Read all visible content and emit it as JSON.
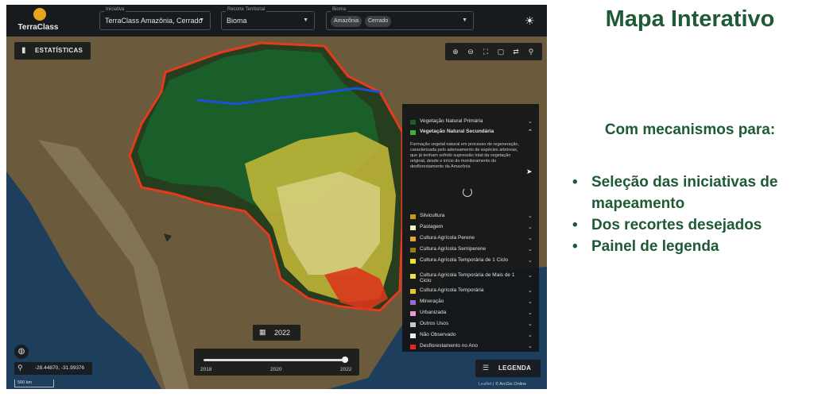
{
  "app": {
    "logo_text": "TerraClass",
    "topbar": {
      "iniciativa": {
        "label": "Iniciativa",
        "value": "TerraClass Amazônia, Cerrado"
      },
      "recorte": {
        "label": "Recorte Territorial",
        "value": "Bioma"
      },
      "bioma": {
        "label": "Bioma",
        "chips": [
          "Amazônia",
          "Cerrado"
        ]
      },
      "theme_icon": "sun-icon"
    },
    "stats_button": "ESTATÍSTICAS",
    "map_tools": [
      "zoom-in-icon",
      "zoom-out-icon",
      "fullscreen-icon",
      "layers-icon",
      "measure-icon",
      "location-pin-icon"
    ],
    "legend": {
      "items": [
        {
          "label": "Vegetação Natural Primária",
          "color": "#1a5e2a"
        },
        {
          "label": "Vegetação Natural Secundária",
          "color": "#3fae3a",
          "expanded": true
        },
        {
          "label": "Silvicultura",
          "color": "#c49a1e"
        },
        {
          "label": "Pastagem",
          "color": "#f3f0c2"
        },
        {
          "label": "Cultura Agrícola Perene",
          "color": "#e8a23a"
        },
        {
          "label": "Cultura Agrícola Semiperene",
          "color": "#9a7a1a"
        },
        {
          "label": "Cultura Agrícola Temporária de 1 Ciclo",
          "color": "#f2e12c"
        },
        {
          "label": "Cultura Agrícola Temporária de Mais de 1 Ciclo",
          "color": "#efe04a"
        },
        {
          "label": "Cultura Agrícola Temporária",
          "color": "#e6c531"
        },
        {
          "label": "Mineração",
          "color": "#9b6bd1"
        },
        {
          "label": "Urbanizada",
          "color": "#e79ad0"
        },
        {
          "label": "Outros Usos",
          "color": "#c7c7c7"
        },
        {
          "label": "Não Observado",
          "color": "#ececec"
        },
        {
          "label": "Desflorestamento no Ano",
          "color": "#e02b1c"
        }
      ],
      "description": "Formação vegetal natural em processo de regeneração, caracterizada pelo adensamento de espécies arbóreas, que já tenham sofrido supressão total da vegetação original, desde o início do monitoramento do desflorestamento da Amazônia"
    },
    "year": "2022",
    "timeline": {
      "labels": [
        "2018",
        "2020",
        "2022"
      ],
      "position": 1.0
    },
    "coordinates": "-28.44870, -31.99376",
    "scale": "500 km",
    "legend_button": "LEGENDA",
    "attribution": {
      "leaflet": "Leaflet",
      "rest": " | © ArcGis Online"
    },
    "colors": {
      "primary_vegetation": "#1a5e2a",
      "deforestation": "#e02b1c",
      "pasture": "#f3f0c2",
      "agriculture": "#f2e12c",
      "ocean": "#1d3e5c",
      "land": "#6e5a3a"
    }
  },
  "slide": {
    "title": "Mapa Interativo",
    "subtitle": "Com mecanismos para:",
    "bullets": [
      "Seleção das iniciativas de mapeamento",
      "Dos recortes desejados",
      "Painel de legenda"
    ],
    "title_color": "#1f5a36"
  }
}
